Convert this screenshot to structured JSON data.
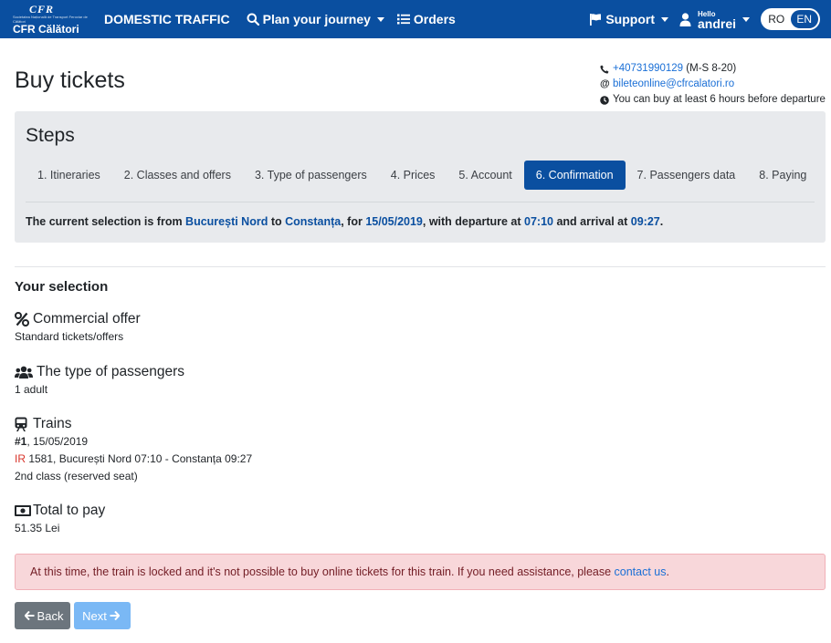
{
  "navbar": {
    "logo_mark": "CFR",
    "logo_tagline": "Societatea Națională de Transport Feroviar de Călători",
    "logo_name": "CFR Călători",
    "domestic": "DOMESTIC TRAFFIC",
    "plan": "Plan your journey",
    "orders": "Orders",
    "support": "Support",
    "user_hello": "Hello",
    "user_name": "andrei",
    "lang_ro": "RO",
    "lang_en": "EN",
    "active_lang": "EN",
    "color": "#0a4fa0"
  },
  "page": {
    "title": "Buy tickets"
  },
  "contact": {
    "phone": "+40731990129",
    "hours": "(M-S 8-20)",
    "email": "bileteonline@cfrcalatori.ro",
    "notice": "You can buy at least 6 hours before departure"
  },
  "steps": {
    "title": "Steps",
    "tabs": [
      {
        "label": "1. Itineraries"
      },
      {
        "label": "2. Classes and offers"
      },
      {
        "label": "3. Type of passengers"
      },
      {
        "label": "4. Prices"
      },
      {
        "label": "5. Account"
      },
      {
        "label": "6. Confirmation"
      },
      {
        "label": "7. Passengers data"
      },
      {
        "label": "8. Paying"
      }
    ],
    "active_index": 5,
    "selection": {
      "t1": "The current selection is from ",
      "from": "București Nord",
      "t2": " to ",
      "to": "Constanța",
      "t3": ", for ",
      "date": "15/05/2019",
      "t4": ", with departure at ",
      "departure": "07:10",
      "t5": " and arrival at ",
      "arrival": "09:27",
      "t6": "."
    }
  },
  "your_selection": {
    "heading": "Your selection",
    "offer": {
      "title": "Commercial offer",
      "value": "Standard tickets/offers"
    },
    "passengers": {
      "title": "The type of passengers",
      "value": "1 adult"
    },
    "trains": {
      "title": "Trains",
      "number": "#1",
      "date": ", 15/05/2019",
      "train_type": "IR",
      "route": " 1581, București Nord 07:10 - Constanța 09:27",
      "class": "2nd class (reserved seat)"
    },
    "total": {
      "title": "Total to pay",
      "value": "51.35 Lei"
    }
  },
  "alert": {
    "text": "At this time, the train is locked and it's not possible to buy online tickets for this train. If you need assistance, please ",
    "link": "contact us",
    "end": "."
  },
  "buttons": {
    "back": "Back",
    "next": "Next"
  }
}
